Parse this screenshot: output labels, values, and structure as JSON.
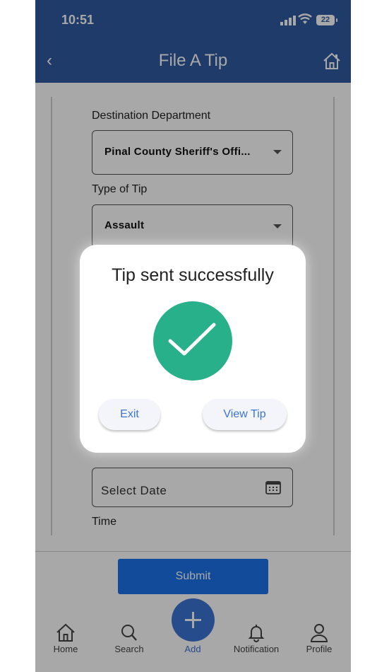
{
  "status_bar": {
    "time": "10:51",
    "battery": "22"
  },
  "app_bar": {
    "title": "File A Tip",
    "back_glyph": "‹"
  },
  "form": {
    "destination_label": "Destination Department",
    "destination_value": "Pinal County Sheriff's Offi...",
    "type_label": "Type of Tip",
    "type_value": "Assault",
    "date_placeholder": "Select Date",
    "time_label": "Time"
  },
  "submit_label": "Submit",
  "nav": [
    {
      "label": "Home",
      "icon": "home-icon"
    },
    {
      "label": "Search",
      "icon": "search-icon"
    },
    {
      "label": "Add",
      "icon": "plus-icon"
    },
    {
      "label": "Notification",
      "icon": "bell-icon"
    },
    {
      "label": "Profile",
      "icon": "person-icon"
    }
  ],
  "dialog": {
    "title": "Tip sent successfully",
    "exit_label": "Exit",
    "view_label": "View Tip",
    "icon": "checkmark-icon"
  },
  "colors": {
    "primary": "#2f5aa0",
    "accent": "#3b74d4",
    "success": "#27b089",
    "submit": "#1a73e8"
  }
}
